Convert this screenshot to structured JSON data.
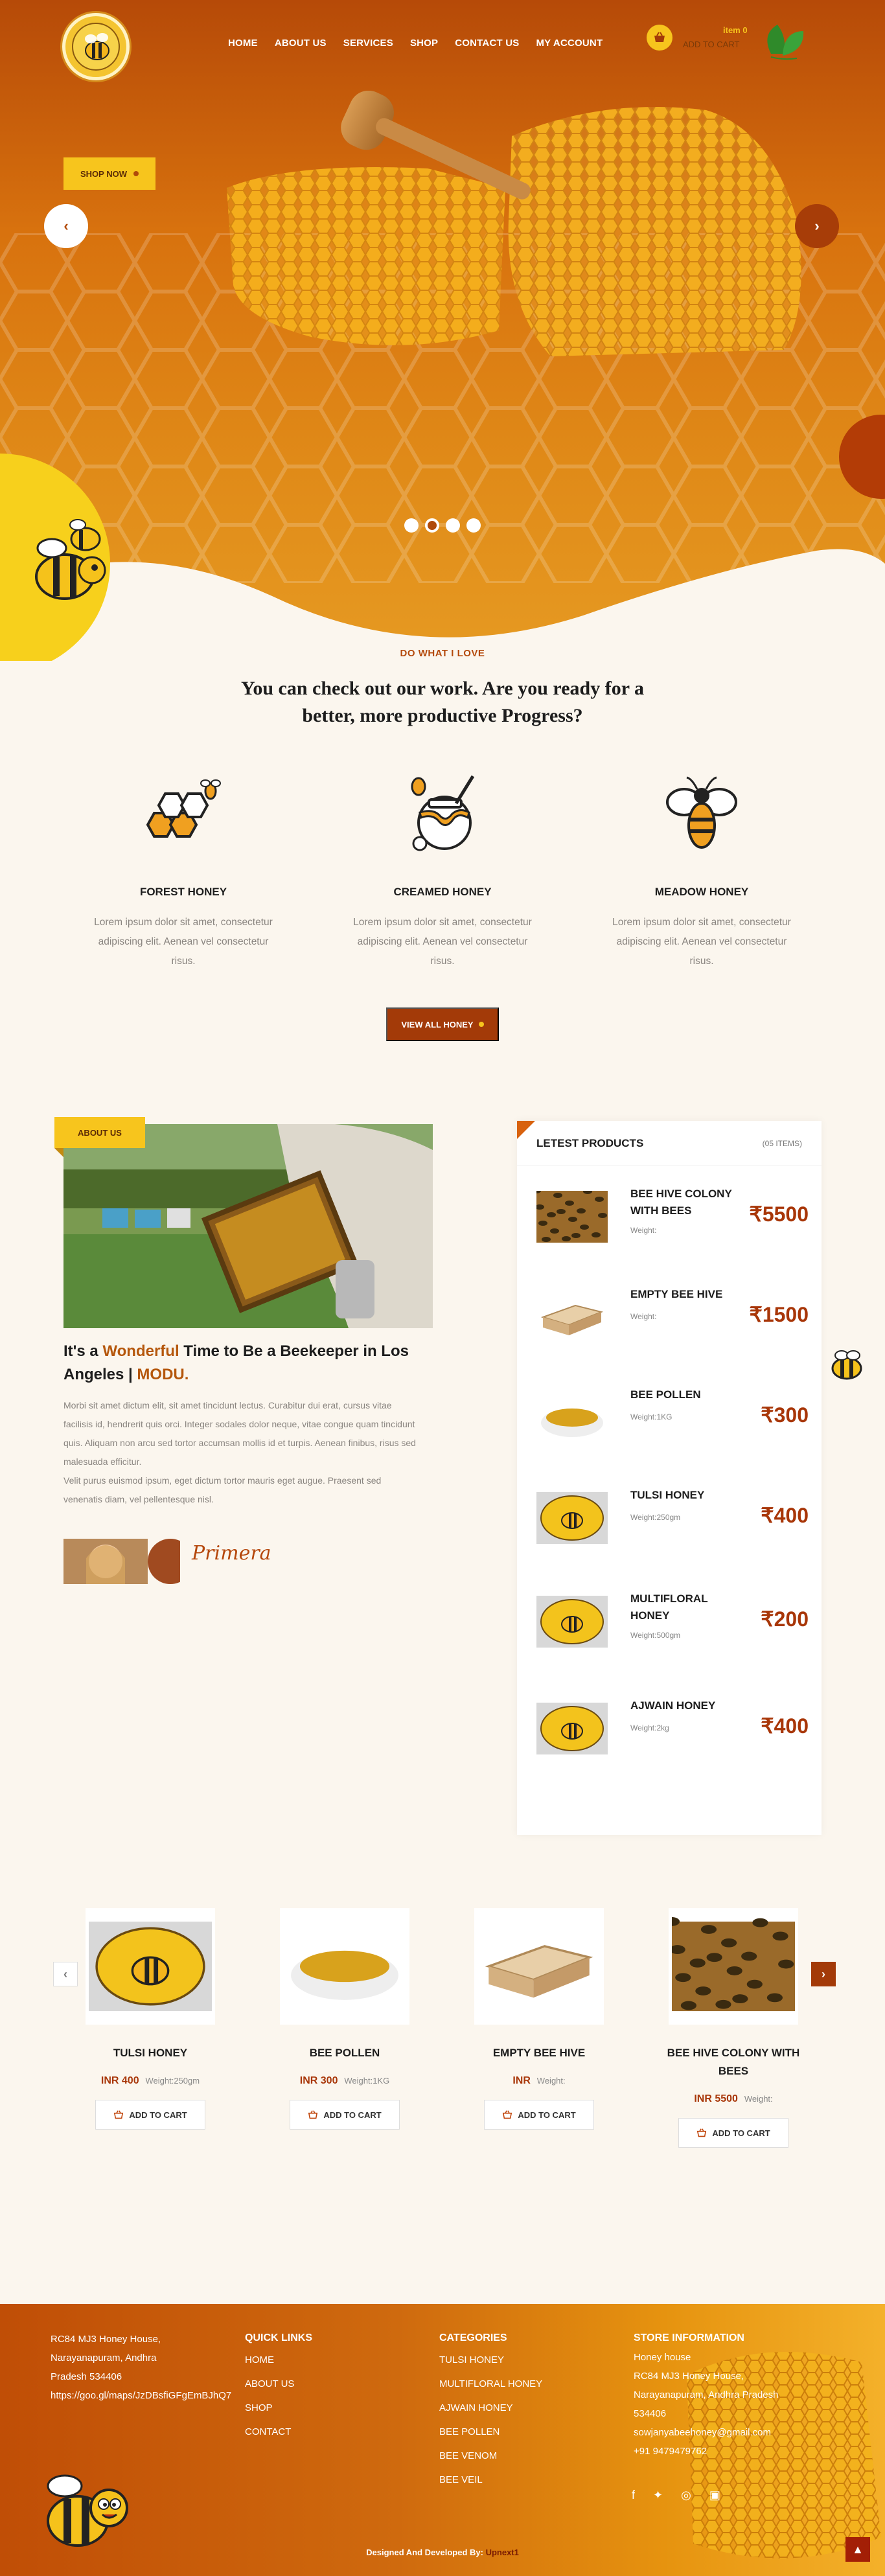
{
  "nav": {
    "links": [
      "HOME",
      "ABOUT US",
      "SERVICES",
      "SHOP",
      "CONTACT US",
      "MY ACCOUNT"
    ],
    "cart_item": "item 0",
    "cart_label": "ADD TO CART"
  },
  "hero": {
    "shop_now": "SHOP NOW",
    "slides": 4,
    "active_slide": 2,
    "prev": "‹",
    "next": "›"
  },
  "services": {
    "eyebrow": "DO WHAT I LOVE",
    "headline": "You can check out our work. Are you ready for a better, more productive Progress?",
    "items": [
      {
        "title": "FOREST HONEY",
        "text": "Lorem ipsum dolor sit amet, consectetur adipiscing elit. Aenean vel consectetur risus.",
        "icon": "honeycomb-bee-icon"
      },
      {
        "title": "CREAMED HONEY",
        "text": "Lorem ipsum dolor sit amet, consectetur adipiscing elit. Aenean vel consectetur risus.",
        "icon": "honey-pot-icon"
      },
      {
        "title": "MEADOW HONEY",
        "text": "Lorem ipsum dolor sit amet, consectetur adipiscing elit. Aenean vel consectetur risus.",
        "icon": "bee-icon"
      }
    ],
    "view_all": "VIEW ALL HONEY"
  },
  "about": {
    "tag": "ABOUT US",
    "title_pre": "It's a ",
    "title_hl1": "Wonderful",
    "title_mid": " Time to Be a Beekeeper in Los Angeles | ",
    "title_hl2": "MODU.",
    "body": "Morbi sit amet dictum elit, sit amet tincidunt lectus. Curabitur dui erat, cursus vitae facilisis id, hendrerit quis orci. Integer sodales dolor neque, vitae congue quam tincidunt quis. Aliquam non arcu sed tortor accumsan mollis id et turpis. Aenean finibus, risus sed malesuada efficitur.",
    "body2": "Velit purus euismod ipsum, eget dictum tortor mauris eget augue. Praesent sed venenatis diam, vel pellentesque nisl.",
    "signature": "Primera"
  },
  "latest": {
    "title": "LETEST PRODUCTS",
    "count": "(05 ITEMS)",
    "products": [
      {
        "name": "BEE HIVE COLONY WITH BEES",
        "weight": "Weight:",
        "price": "₹5500",
        "thumb": "bees"
      },
      {
        "name": "EMPTY BEE HIVE",
        "weight": "Weight:",
        "price": "₹1500",
        "thumb": "box"
      },
      {
        "name": "BEE POLLEN",
        "weight": "Weight:1KG",
        "price": "₹300",
        "thumb": "pollen"
      },
      {
        "name": "TULSI HONEY",
        "weight": "Weight:250gm",
        "price": "₹400",
        "thumb": "label"
      },
      {
        "name": "MULTIFLORAL HONEY",
        "weight": "Weight:500gm",
        "price": "₹200",
        "thumb": "label"
      },
      {
        "name": "AJWAIN HONEY",
        "weight": "Weight:2kg",
        "price": "₹400",
        "thumb": "label"
      }
    ]
  },
  "carousel": {
    "atc": "ADD TO CART",
    "items": [
      {
        "name": "TULSI HONEY",
        "price": "INR 400",
        "weight": "Weight:250gm",
        "img": "label"
      },
      {
        "name": "BEE POLLEN",
        "price": "INR 300",
        "weight": "Weight:1KG",
        "img": "pollen"
      },
      {
        "name": "EMPTY BEE HIVE",
        "price": "INR",
        "weight": "Weight:",
        "img": "box"
      },
      {
        "name": "BEE HIVE COLONY WITH BEES",
        "price": "INR 5500",
        "weight": "Weight:",
        "img": "bees"
      }
    ]
  },
  "footer": {
    "address": [
      "RC84 MJ3 Honey House,",
      "Narayanapuram, Andhra",
      "Pradesh 534406",
      "https://goo.gl/maps/JzDBsfiGFgEmBJhQ7"
    ],
    "quick_title": "QUICK LINKS",
    "quick": [
      "HOME",
      "ABOUT US",
      "SHOP",
      "CONTACT"
    ],
    "cat_title": "CATEGORIES",
    "categories": [
      "TULSI HONEY",
      "MULTIFLORAL HONEY",
      "AJWAIN HONEY",
      "BEE POLLEN",
      "BEE VENOM",
      "BEE VEIL"
    ],
    "store_title": "STORE INFORMATION",
    "store": [
      "Honey house",
      "RC84 MJ3 Honey House,",
      "Narayanapuram, Andhra Pradesh",
      "534406",
      "sowjanyabeehoney@gmail.com",
      "+91 9479479762"
    ],
    "credit": "Designed And Developed By:",
    "brand": "Upnext1"
  },
  "colors": {
    "accent": "#a33a08",
    "yellow": "#f7c51d",
    "orange": "#d8720e"
  }
}
